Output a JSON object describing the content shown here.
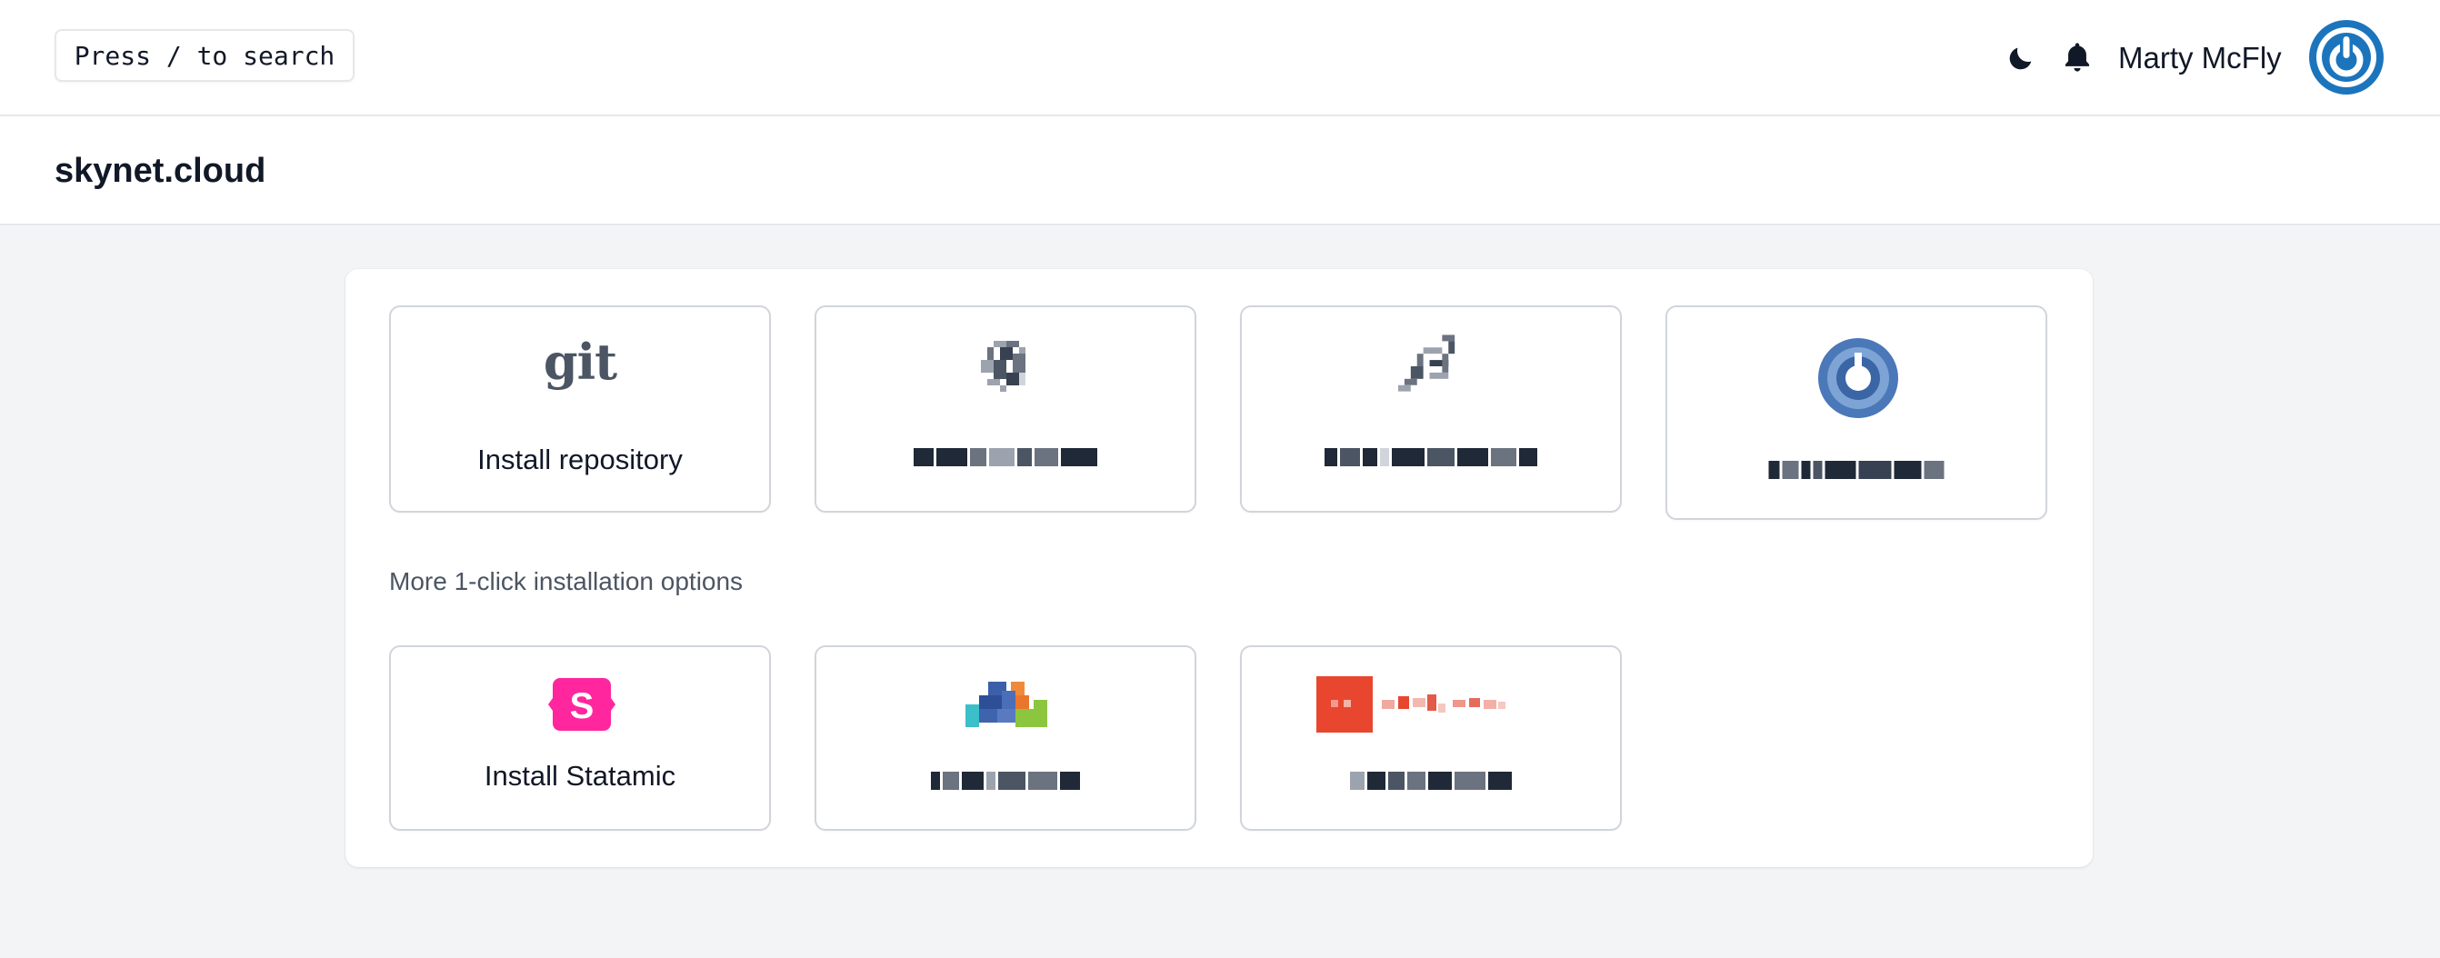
{
  "header": {
    "search_placeholder": "Press / to search",
    "user_name": "Marty McFly",
    "icons": [
      "moon-icon",
      "bell-icon",
      "power-avatar-icon"
    ],
    "avatar_color": "#1c75bc"
  },
  "page": {
    "title": "skynet.cloud"
  },
  "cards_primary": [
    {
      "label": "Install repository",
      "icon": "git-icon"
    },
    {
      "label": "",
      "icon": "pixelated-icon"
    },
    {
      "label": "",
      "icon": "pixelated-icon"
    },
    {
      "label": "",
      "icon": "pixelated-gear-icon"
    }
  ],
  "section": {
    "more_label": "More 1-click installation options"
  },
  "cards_more": [
    {
      "label": "Install Statamic",
      "icon": "statamic-icon",
      "color": "#ff269e"
    },
    {
      "label": "",
      "icon": "pixelated-logo-icon"
    },
    {
      "label": "",
      "icon": "pixelated-brand-icon",
      "color": "#e8462f"
    }
  ]
}
